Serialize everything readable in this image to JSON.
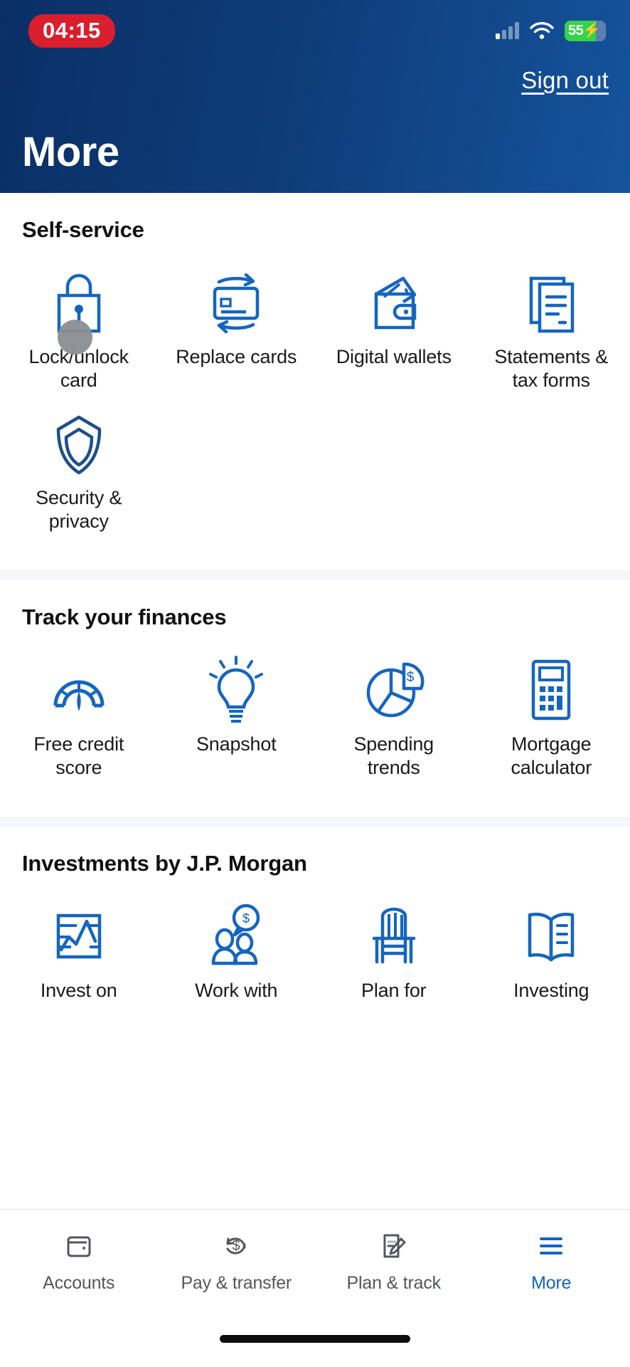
{
  "status_bar": {
    "recording_time": "04:15",
    "battery_percent": "55",
    "battery_charging": true,
    "signal_icon": "cellular-signal-icon",
    "wifi_icon": "wifi-icon"
  },
  "header": {
    "sign_out_label": "Sign out",
    "title": "More",
    "background_color": "#0e3c78"
  },
  "accent_color": "#1565c0",
  "sections": [
    {
      "title": "Self-service",
      "items": [
        {
          "label": "Lock/unlock card",
          "icon": "padlock-icon"
        },
        {
          "label": "Replace cards",
          "icon": "card-refresh-icon"
        },
        {
          "label": "Digital wallets",
          "icon": "wallet-icon"
        },
        {
          "label": "Statements & tax forms",
          "icon": "documents-icon"
        },
        {
          "label": "Security & privacy",
          "icon": "shield-icon"
        }
      ]
    },
    {
      "title": "Track your finances",
      "items": [
        {
          "label": "Free credit score",
          "icon": "gauge-icon"
        },
        {
          "label": "Snapshot",
          "icon": "lightbulb-icon"
        },
        {
          "label": "Spending trends",
          "icon": "pie-chart-dollar-icon"
        },
        {
          "label": "Mortgage calculator",
          "icon": "calculator-icon"
        }
      ]
    },
    {
      "title": "Investments by J.P. Morgan",
      "items": [
        {
          "label": "Invest on",
          "icon": "line-chart-icon"
        },
        {
          "label": "Work with",
          "icon": "people-dollar-icon"
        },
        {
          "label": "Plan for",
          "icon": "chair-icon"
        },
        {
          "label": "Investing",
          "icon": "open-book-icon"
        }
      ]
    }
  ],
  "tab_bar": {
    "active": "More",
    "tabs": [
      {
        "label": "Accounts",
        "icon": "wallet-tab-icon"
      },
      {
        "label": "Pay & transfer",
        "icon": "dollar-refresh-tab-icon"
      },
      {
        "label": "Plan & track",
        "icon": "document-pencil-tab-icon"
      },
      {
        "label": "More",
        "icon": "hamburger-tab-icon"
      }
    ]
  }
}
